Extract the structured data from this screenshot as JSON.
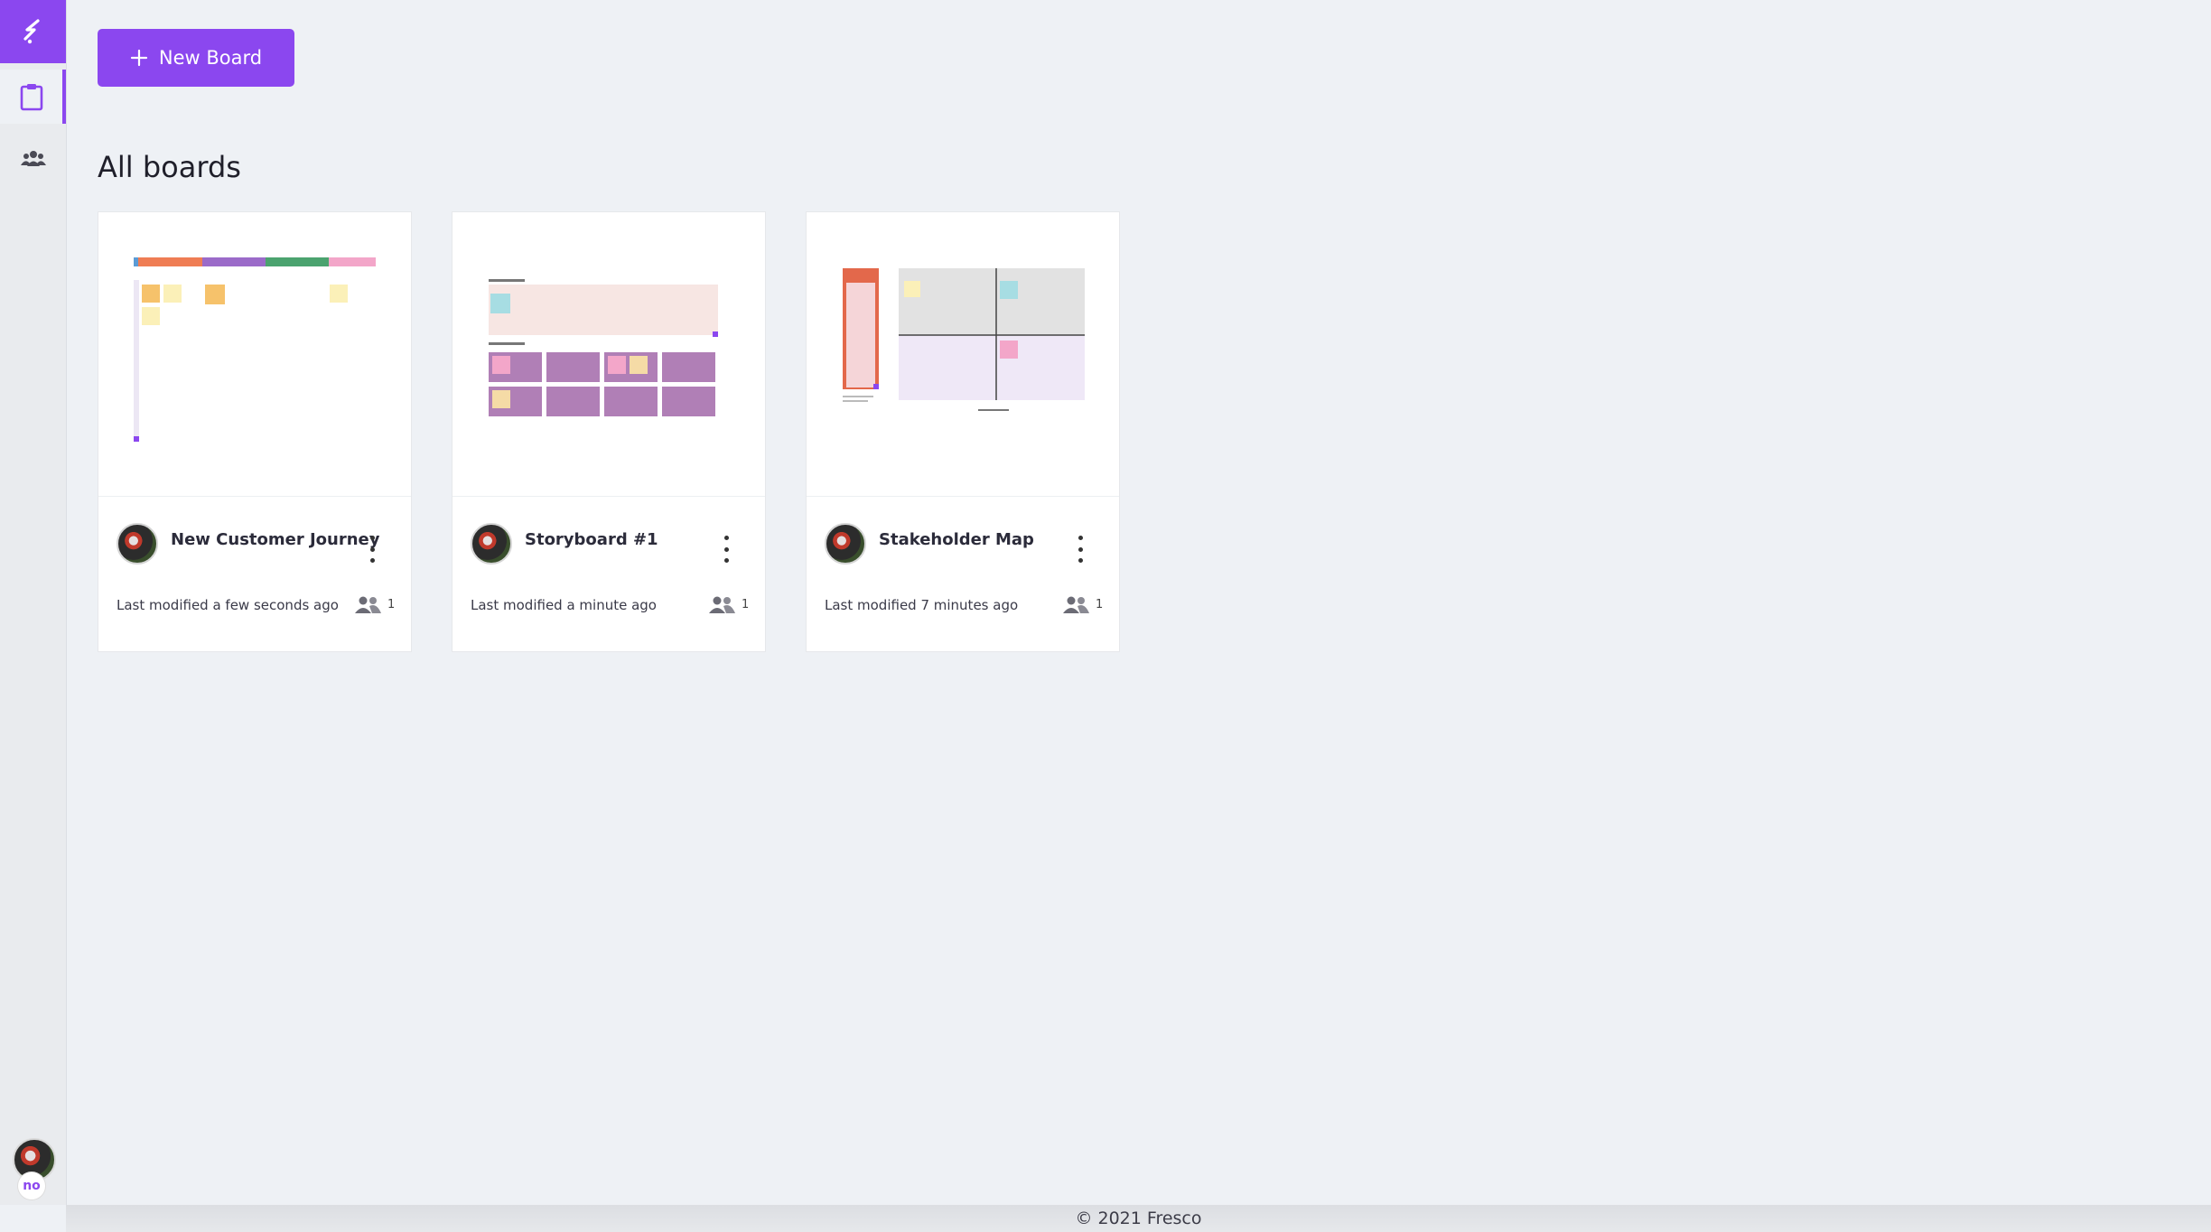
{
  "sidebar": {
    "logo_icon": "fresco-logo-icon",
    "items": [
      {
        "name": "boards",
        "icon": "clipboard-icon",
        "active": true
      },
      {
        "name": "teams",
        "icon": "users-icon",
        "active": false
      }
    ],
    "user_badge": "no"
  },
  "toolbar": {
    "new_board_label": "New Board"
  },
  "main": {
    "section_title": "All boards",
    "boards": [
      {
        "title": "New Customer Journey",
        "modified": "Last modified a few seconds ago",
        "members": "1"
      },
      {
        "title": "Storyboard #1",
        "modified": "Last modified a minute ago",
        "members": "1"
      },
      {
        "title": "Stakeholder Map",
        "modified": "Last modified 7 minutes ago",
        "members": "1"
      }
    ]
  },
  "footer": {
    "copyright": "© 2021 Fresco"
  },
  "colors": {
    "accent": "#8b47ef",
    "background": "#eef1f5"
  }
}
